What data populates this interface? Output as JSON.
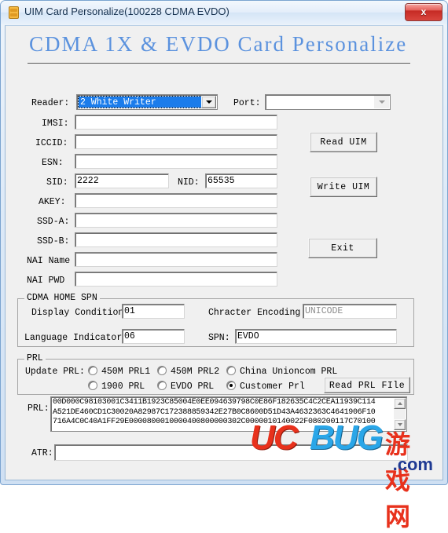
{
  "window": {
    "title": "UIM Card Personalize(100228 CDMA EVDO)",
    "icon": "uim-card-icon",
    "close_label": "x",
    "accent_blue": "#5b92de",
    "title_text_color": "#16314e",
    "close_button_color": "#c62b24"
  },
  "banner": {
    "heading": "CDMA 1X & EVDO Card Personalize"
  },
  "form": {
    "reader": {
      "label": "Reader:",
      "value": "2 White Writer",
      "selected_highlight": "#1b7ceb"
    },
    "port": {
      "label": "Port:",
      "value": "",
      "placeholder": ""
    },
    "fields": [
      {
        "label": "IMSI:",
        "value": ""
      },
      {
        "label": "ICCID:",
        "value": ""
      },
      {
        "label": "ESN:",
        "value": ""
      },
      {
        "label": "AKEY:",
        "value": ""
      },
      {
        "label": "SSD-A:",
        "value": ""
      },
      {
        "label": "SSD-B:",
        "value": ""
      },
      {
        "label": "NAI Name",
        "value": ""
      },
      {
        "label": "NAI PWD",
        "value": ""
      }
    ],
    "sid": {
      "label": "SID:",
      "value": "2222"
    },
    "nid": {
      "label": "NID:",
      "value": "65535"
    }
  },
  "buttons": {
    "read_uim": "Read UIM",
    "write_uim": "Write UIM",
    "exit": "Exit",
    "read_prl_file": "Read PRL FIle"
  },
  "cdma_home_spn": {
    "title": "CDMA HOME SPN",
    "display_condition": {
      "label": "Display Condition:",
      "value": "01"
    },
    "language_indicator": {
      "label": "Language Indicator:",
      "value": "06"
    },
    "character_encoding": {
      "label": "Chracter Encoding:",
      "value": "UNICODE",
      "readonly": true
    },
    "spn": {
      "label": "SPN:",
      "value": "EVDO"
    }
  },
  "prl_group": {
    "title": "PRL",
    "update_label": "Update PRL:",
    "options": [
      {
        "label": "450M PRL1",
        "selected": false
      },
      {
        "label": "450M PRL2",
        "selected": false
      },
      {
        "label": "China Unioncom PRL",
        "selected": false
      },
      {
        "label": "1900 PRL",
        "selected": false
      },
      {
        "label": "EVDO PRL",
        "selected": false
      },
      {
        "label": "Customer Prl",
        "selected": true
      }
    ],
    "prl_label": "PRL:",
    "prl_value": "00D000C98103001C3411B1923C85004E0EE094639798C0E86F182635C4C2CEA11939C114\nA521DE460CD1C30020A82987C172388859342E27B0C8600D51D43A4632363C4641906F10\n716A4C0C40A1FF29E0000800010000400800000302C0000010140022F080200117C70100"
  },
  "atr": {
    "label": "ATR:",
    "value": ""
  },
  "watermark": {
    "uc": "UC",
    "bug": "BUG",
    "cn": "游戏网",
    "com": ".com",
    "uc_color": "#e8311c",
    "bug_color": "#2aa6e8",
    "com_color": "#1f3a93"
  }
}
